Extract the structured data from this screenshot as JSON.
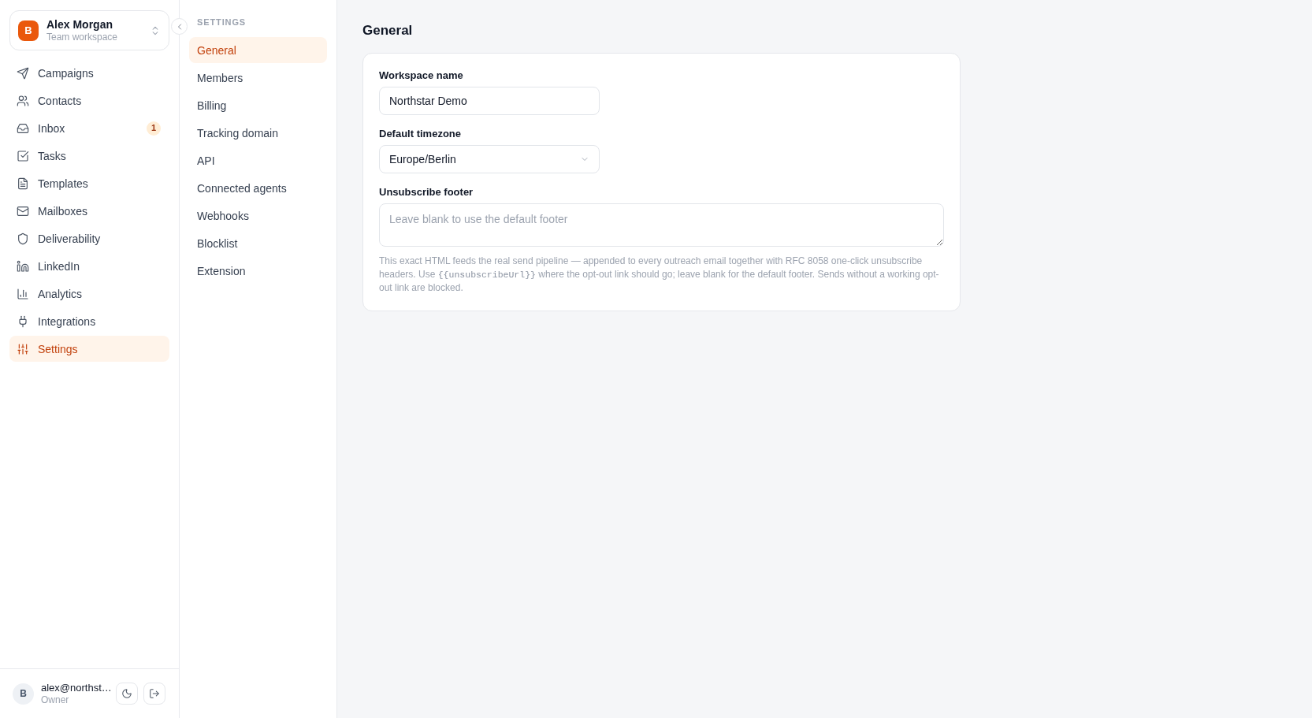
{
  "workspace": {
    "avatar": "B",
    "name": "Alex Morgan",
    "subtitle": "Team workspace"
  },
  "nav": [
    {
      "label": "Campaigns",
      "selected": false
    },
    {
      "label": "Contacts",
      "selected": false
    },
    {
      "label": "Inbox",
      "selected": false,
      "badge": "1"
    },
    {
      "label": "Tasks",
      "selected": false
    },
    {
      "label": "Templates",
      "selected": false
    },
    {
      "label": "Mailboxes",
      "selected": false
    },
    {
      "label": "Deliverability",
      "selected": false
    },
    {
      "label": "LinkedIn",
      "selected": false
    },
    {
      "label": "Analytics",
      "selected": false
    },
    {
      "label": "Integrations",
      "selected": false
    },
    {
      "label": "Settings",
      "selected": true
    }
  ],
  "user": {
    "avatar": "B",
    "email": "alex@northst…",
    "role": "Owner"
  },
  "settings_nav": {
    "heading": "SETTINGS",
    "items": [
      {
        "label": "General",
        "selected": true
      },
      {
        "label": "Members",
        "selected": false
      },
      {
        "label": "Billing",
        "selected": false
      },
      {
        "label": "Tracking domain",
        "selected": false
      },
      {
        "label": "API",
        "selected": false
      },
      {
        "label": "Connected agents",
        "selected": false
      },
      {
        "label": "Webhooks",
        "selected": false
      },
      {
        "label": "Blocklist",
        "selected": false
      },
      {
        "label": "Extension",
        "selected": false
      }
    ]
  },
  "page": {
    "title": "General",
    "fields": [
      {
        "kind": "text",
        "label": "Workspace name",
        "value": "Northstar Demo"
      },
      {
        "kind": "select",
        "label": "Default timezone",
        "value": "Europe/Berlin"
      },
      {
        "kind": "textarea",
        "label": "Unsubscribe footer",
        "placeholder": "Leave blank to use the default footer",
        "help": [
          {
            "kind": "text",
            "text": "This exact HTML feeds the real send pipeline — appended to every outreach email together with RFC 8058 one-click unsubscribe headers. Use "
          },
          {
            "kind": "code",
            "text": "{{unsubscribeUrl}}"
          },
          {
            "kind": "text",
            "text": " where the opt-out link should go; leave blank for the default footer. Sends without a working opt-out link are blocked."
          }
        ]
      }
    ]
  }
}
